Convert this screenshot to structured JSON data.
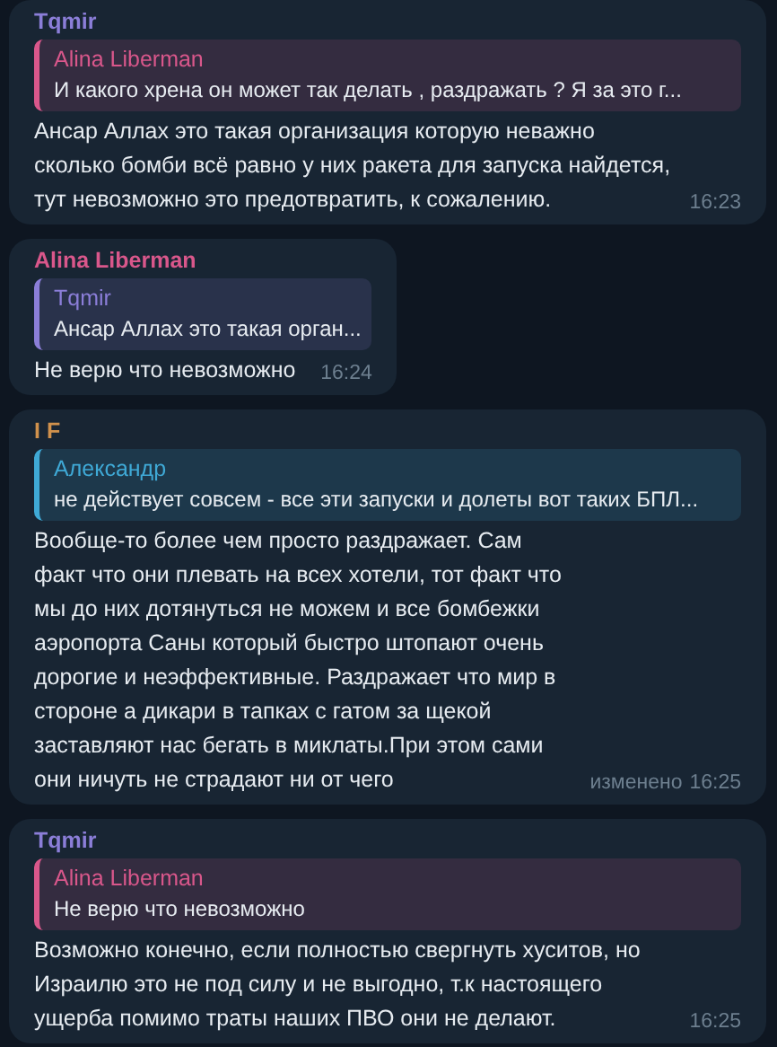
{
  "messages": [
    {
      "author": {
        "name": "Tqmir",
        "color": "#8b7ed8"
      },
      "reply": {
        "name": "Alina Liberman",
        "color": "#d9578b",
        "text": "И какого хрена он может так делать , раздражать ? Я за это г..."
      },
      "text": "Ансар Аллах это такая организация которую неважно сколько бомби всё равно у них ракета для запуска найдется, тут невозможно это предотвратить, к сожалению.",
      "time": "16:23"
    },
    {
      "author": {
        "name": "Alina Liberman",
        "color": "#d9578b"
      },
      "reply": {
        "name": "Tqmir",
        "color": "#8b7ed8",
        "text": "Ансар Аллах это такая орган..."
      },
      "text": "Не верю что невозможно",
      "time": "16:24"
    },
    {
      "author": {
        "name": "I F",
        "color": "#d0914c"
      },
      "reply": {
        "name": "Александр",
        "color": "#3fa9d6",
        "text": "не действует совсем - все эти запуски и долеты вот таких БПЛ..."
      },
      "text": "Вообще-то более чем просто раздражает. Сам факт что они плевать на всех хотели, тот факт что мы до них дотянуться не можем и все бомбежки аэропорта Саны который быстро штопают очень дорогие и неэффективные. Раздражает что мир в стороне а дикари в тапках с гатом за щекой заставляют нас бегать в миклаты.При этом сами они ничуть не страдают ни от чего",
      "edited": "изменено",
      "time": "16:25"
    },
    {
      "author": {
        "name": "Tqmir",
        "color": "#8b7ed8"
      },
      "reply": {
        "name": "Alina Liberman",
        "color": "#d9578b",
        "text": "Не верю что невозможно"
      },
      "text": "Возможно конечно, если полностью свергнуть хуситов, но Израилю это не под силу и не выгодно, т.к настоящего ущерба помимо траты наших ПВО они не делают.",
      "time": "16:25"
    }
  ]
}
